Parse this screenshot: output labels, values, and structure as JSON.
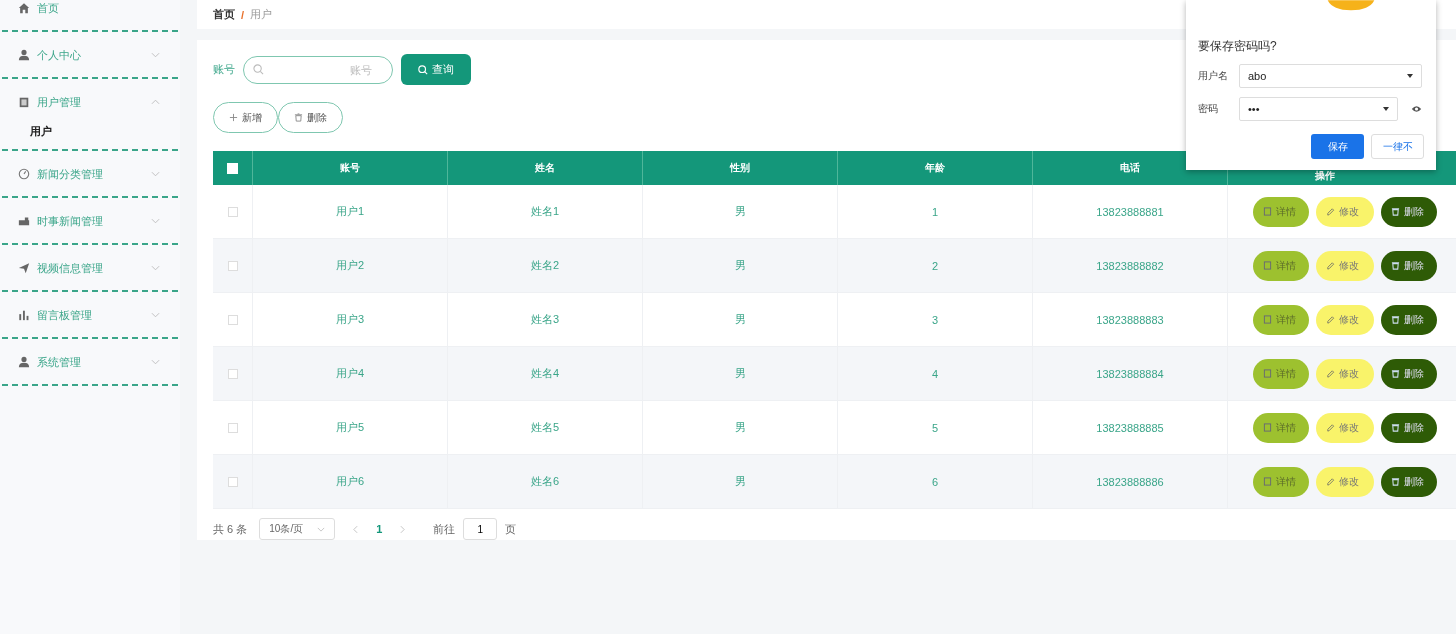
{
  "sidebar": {
    "items": [
      {
        "label": "首页"
      },
      {
        "label": "个人中心",
        "expanded": false
      },
      {
        "label": "用户管理",
        "expanded": true,
        "children": [
          {
            "label": "用户",
            "selected": true
          }
        ]
      },
      {
        "label": "新闻分类管理",
        "expanded": false
      },
      {
        "label": "时事新闻管理",
        "expanded": false
      },
      {
        "label": "视频信息管理",
        "expanded": false
      },
      {
        "label": "留言板管理",
        "expanded": false
      },
      {
        "label": "系统管理",
        "expanded": false
      }
    ]
  },
  "breadcrumb": [
    "首页",
    "/",
    "用户"
  ],
  "search": {
    "label": "账号",
    "placeholder": "账号",
    "button": "查询"
  },
  "actions": [
    "新增",
    "删除"
  ],
  "table": {
    "select_all_checked": false,
    "columns": [
      "账号",
      "姓名",
      "性别",
      "年龄",
      "电话",
      "操作"
    ],
    "rows": [
      {
        "checked": false,
        "cells": [
          "用户1",
          "姓名1",
          "男",
          "1",
          "13823888881"
        ],
        "buttons": [
          "详情",
          "修改",
          "删除"
        ]
      },
      {
        "checked": false,
        "cells": [
          "用户2",
          "姓名2",
          "男",
          "2",
          "13823888882"
        ],
        "buttons": [
          "详情",
          "修改",
          "删除"
        ]
      },
      {
        "checked": false,
        "cells": [
          "用户3",
          "姓名3",
          "男",
          "3",
          "13823888883"
        ],
        "buttons": [
          "详情",
          "修改",
          "删除"
        ]
      },
      {
        "checked": false,
        "cells": [
          "用户4",
          "姓名4",
          "男",
          "4",
          "13823888884"
        ],
        "buttons": [
          "详情",
          "修改",
          "删除"
        ]
      },
      {
        "checked": false,
        "cells": [
          "用户5",
          "姓名5",
          "男",
          "5",
          "13823888885"
        ],
        "buttons": [
          "详情",
          "修改",
          "删除"
        ]
      },
      {
        "checked": false,
        "cells": [
          "用户6",
          "姓名6",
          "男",
          "6",
          "13823888886"
        ],
        "buttons": [
          "详情",
          "修改",
          "删除"
        ]
      }
    ]
  },
  "pagination": {
    "total": "共 6 条",
    "page_size": "10条/页",
    "pages": [
      {
        "label": "1",
        "selected": true
      }
    ],
    "goto_label": "前往",
    "goto_value": "1",
    "goto_suffix": "页"
  },
  "password_popup": {
    "title": "要保存密码吗?",
    "username_label": "用户名",
    "username": "abo",
    "password_label": "密码",
    "password": "•••",
    "save": "保存",
    "never": "一律不"
  }
}
